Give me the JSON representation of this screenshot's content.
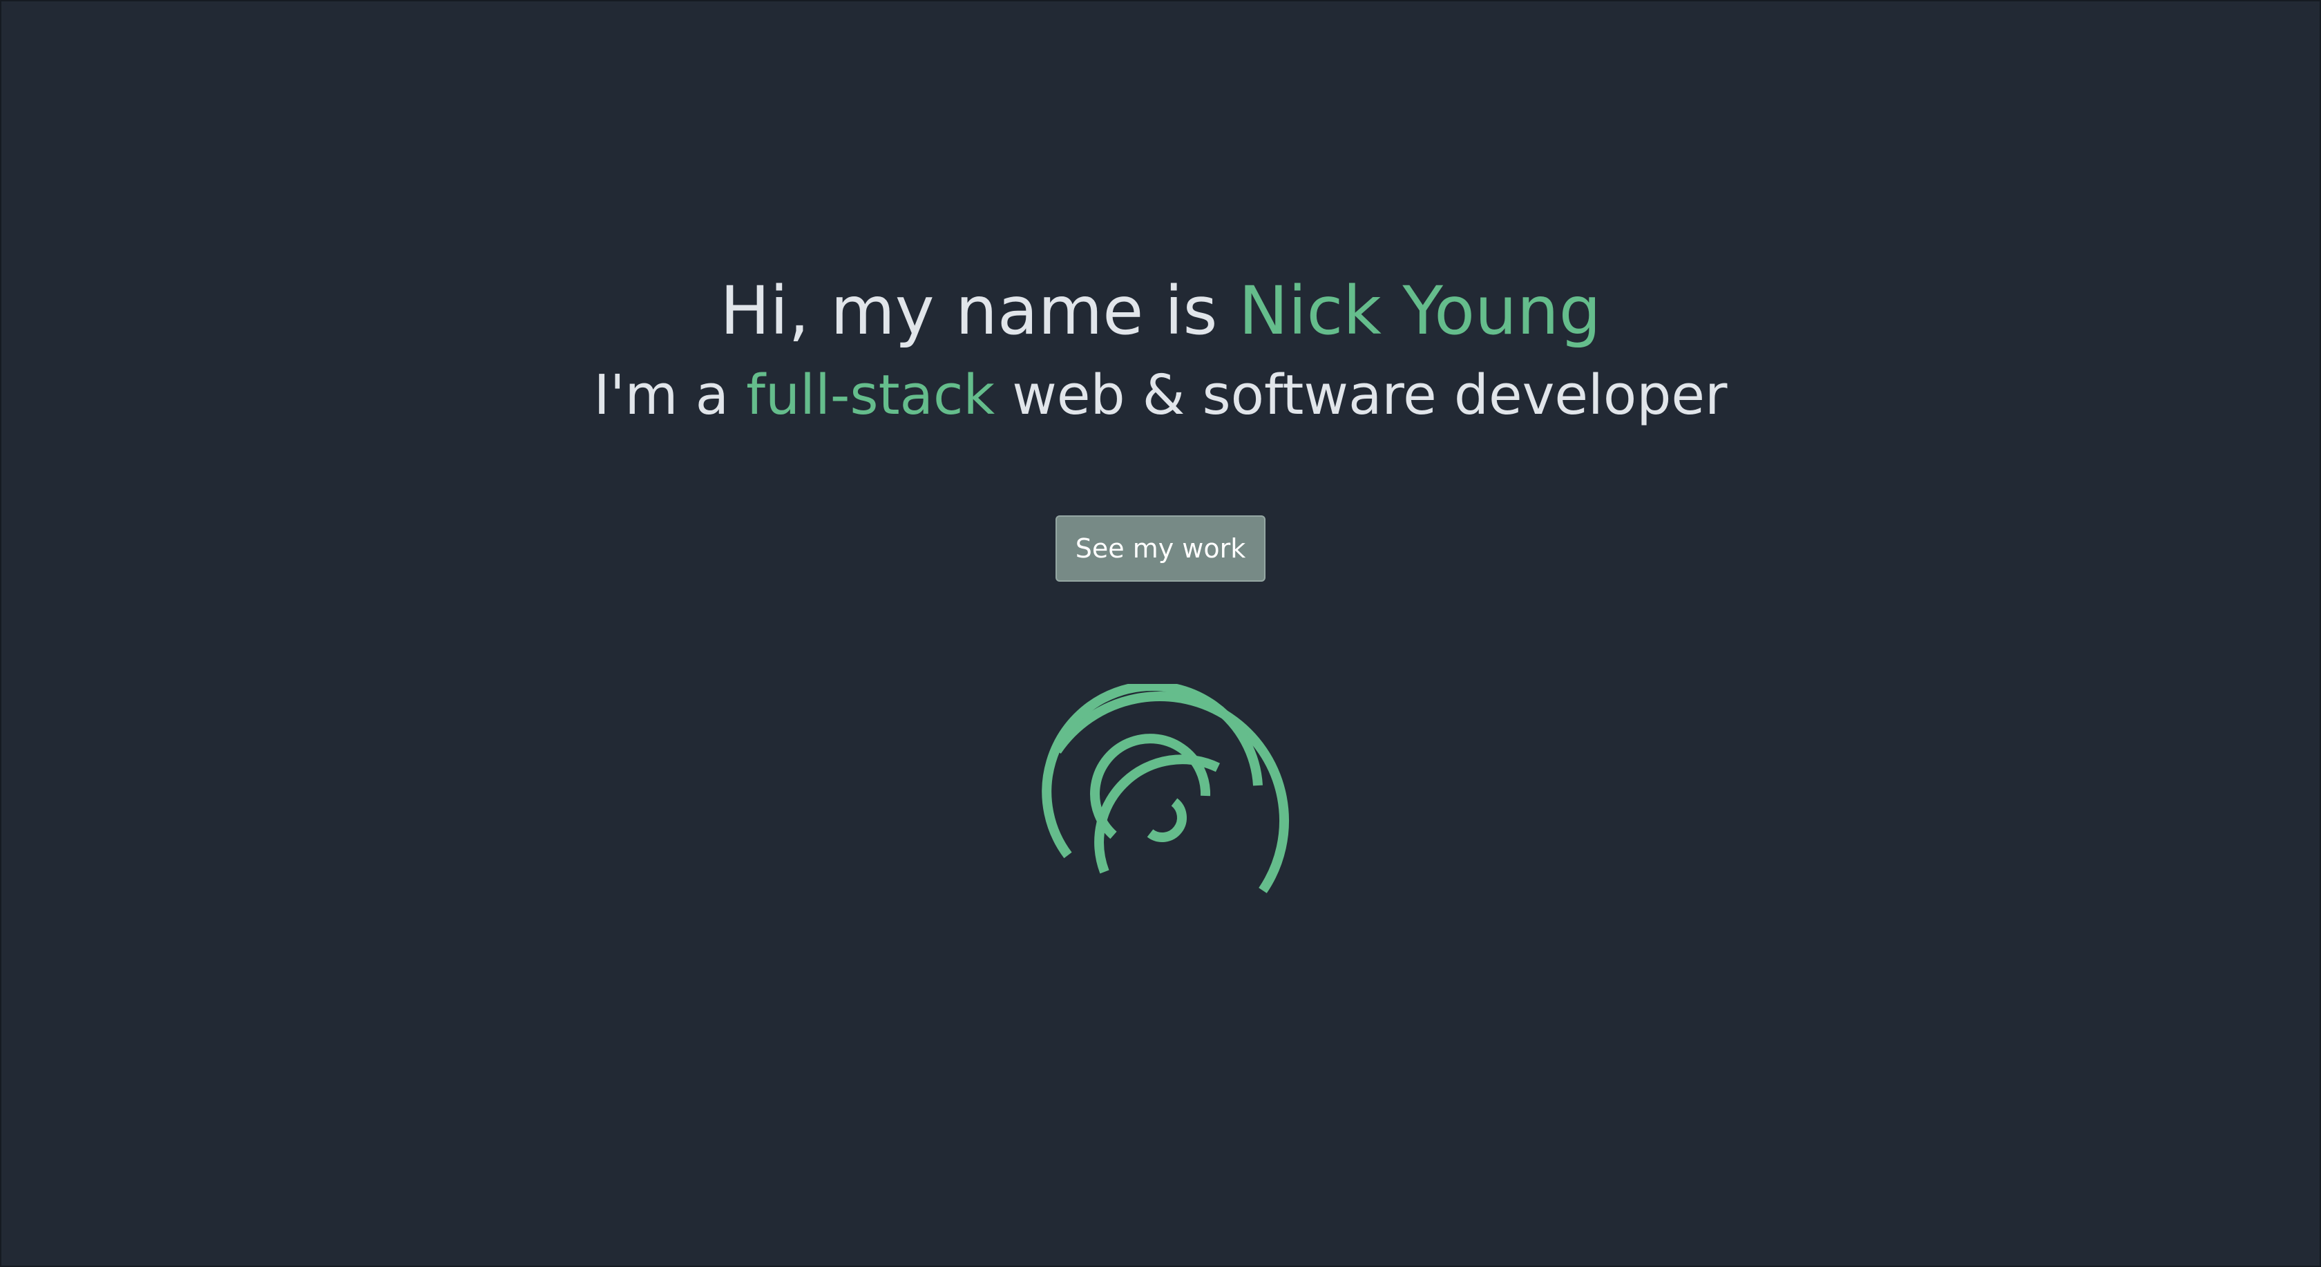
{
  "hero": {
    "greeting_prefix": "Hi, my name is ",
    "name": "Nick Young",
    "role_prefix": "I'm a ",
    "role_highlight": "full-stack",
    "role_suffix": " web & software developer"
  },
  "cta": {
    "label": "See my work"
  },
  "colors": {
    "background": "#222934",
    "text": "#e1e5ea",
    "accent": "#65bd8c",
    "button": "#778a86"
  },
  "icons": {
    "loader": "concentric-arc-spinner-icon"
  }
}
